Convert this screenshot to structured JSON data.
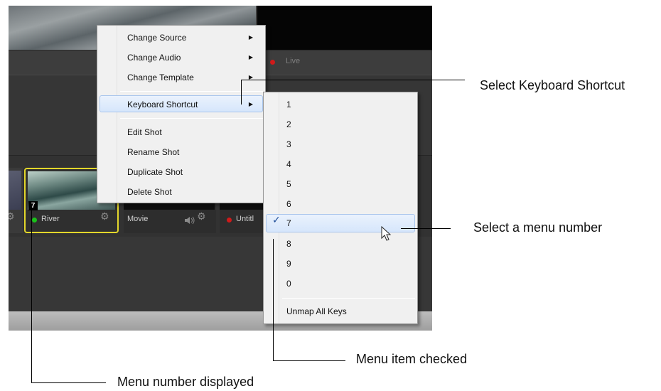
{
  "status": {
    "live_label": "Live"
  },
  "shots": [
    {
      "name": "",
      "status_color": "",
      "shortcut": ""
    },
    {
      "name": "River",
      "status_color": "#19c219",
      "shortcut": "7"
    },
    {
      "name": "Movie",
      "status_color": "",
      "shortcut": ""
    },
    {
      "name": "Untitl",
      "status_color": "#d01a1a",
      "shortcut": ""
    }
  ],
  "context_menu": {
    "items": [
      {
        "label": "Change Source",
        "has_submenu": true
      },
      {
        "label": "Change Audio",
        "has_submenu": true
      },
      {
        "label": "Change Template",
        "has_submenu": true
      },
      {
        "label": "Keyboard Shortcut",
        "has_submenu": true,
        "highlighted": true
      },
      {
        "label": "Edit Shot"
      },
      {
        "label": "Rename Shot"
      },
      {
        "label": "Duplicate Shot"
      },
      {
        "label": "Delete Shot"
      }
    ]
  },
  "shortcut_submenu": {
    "items": [
      "1",
      "2",
      "3",
      "4",
      "5",
      "6",
      "7",
      "8",
      "9",
      "0"
    ],
    "checked": "7",
    "highlighted": "7",
    "unmap_label": "Unmap All Keys"
  },
  "annotations": {
    "select_shortcut": "Select Keyboard Shortcut",
    "select_number": "Select a menu number",
    "item_checked": "Menu item checked",
    "number_displayed": "Menu number displayed"
  },
  "icons": [
    "gear-icon",
    "speaker-icon",
    "submenu-arrow-icon",
    "checkmark-icon",
    "mouse-cursor-icon"
  ],
  "colors": {
    "selection_border": "#e3d72b",
    "live_dot": "#d01a1a",
    "active_dot": "#19c219",
    "check": "#1f4e99"
  }
}
